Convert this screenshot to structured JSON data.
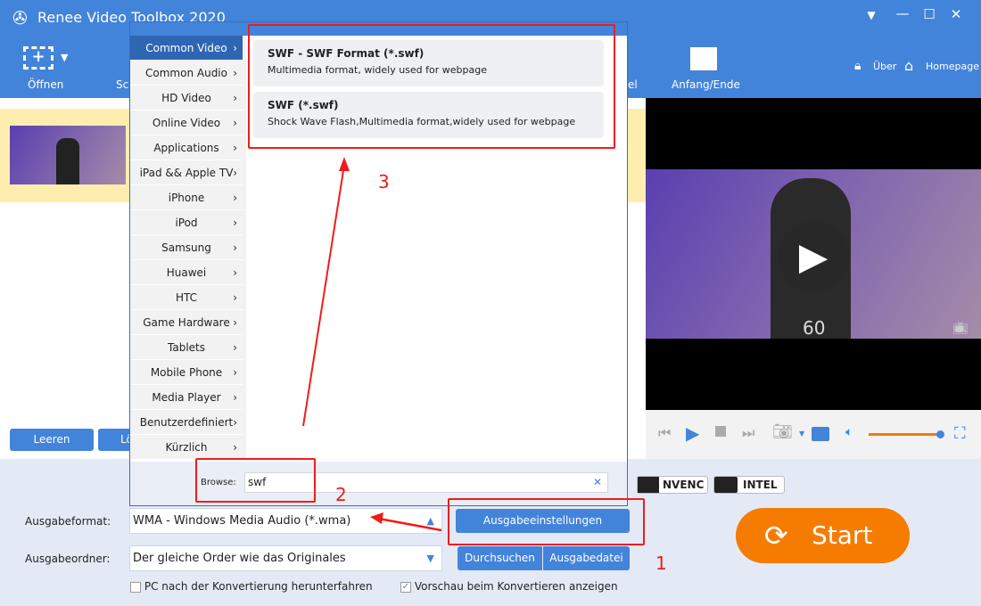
{
  "app": {
    "title": "Renee Video Toolbox 2020"
  },
  "toolbar": {
    "open": "Öffnen",
    "cut_partial": "Sc",
    "partial_right": "el",
    "start_end": "Anfang/Ende",
    "about": "Über",
    "homepage": "Homepage"
  },
  "left": {
    "clear": "Leeren",
    "delete_partial": "Lö"
  },
  "video": {
    "overlay_text": "60"
  },
  "dialog": {
    "categories": [
      "Common Video",
      "Common Audio",
      "HD Video",
      "Online Video",
      "Applications",
      "iPad && Apple TV",
      "iPhone",
      "iPod",
      "Samsung",
      "Huawei",
      "HTC",
      "Game Hardware",
      "Tablets",
      "Mobile Phone",
      "Media Player",
      "Benutzerdefiniert",
      "Kürzlich"
    ],
    "selected_category": "Common Video",
    "formats": [
      {
        "title": "SWF - SWF Format (*.swf)",
        "desc": "Multimedia format, widely used for webpage"
      },
      {
        "title": "SWF (*.swf)",
        "desc": "Shock Wave Flash,Multimedia format,widely used for webpage"
      }
    ],
    "browse_label": "Browse:",
    "browse_value": "swf"
  },
  "accel": {
    "nvenc": "NVENC",
    "intel": "INTEL"
  },
  "output": {
    "format_label": "Ausgabeformat:",
    "format_value": "WMA - Windows Media Audio (*.wma)",
    "settings_btn": "Ausgabeeinstellungen",
    "folder_label": "Ausgabeordner:",
    "folder_value": "Der gleiche Order wie das Originales",
    "browse_btn": "Durchsuchen",
    "output_file_btn": "Ausgabedatei",
    "shutdown_label": "PC nach der Konvertierung herunterfahren",
    "shutdown_checked": false,
    "preview_label": "Vorschau beim Konvertieren anzeigen",
    "preview_checked": true,
    "start": "Start"
  },
  "annotations": {
    "one": "1",
    "two": "2",
    "three": "3"
  },
  "colors": {
    "primary": "#4384db",
    "start": "#f57c00",
    "annotation": "#f01c1c"
  },
  "player": {
    "volume_percent": 100
  }
}
